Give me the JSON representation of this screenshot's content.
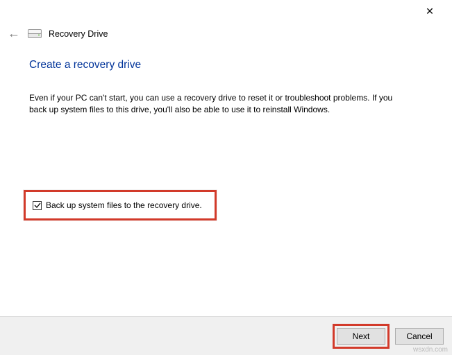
{
  "window": {
    "close_tooltip": "Close"
  },
  "header": {
    "title": "Recovery Drive"
  },
  "page": {
    "title": "Create a recovery drive",
    "description": "Even if your PC can't start, you can use a recovery drive to reset it or troubleshoot problems. If you back up system files to this drive, you'll also be able to use it to reinstall Windows."
  },
  "checkbox": {
    "label": "Back up system files to the recovery drive.",
    "checked": true
  },
  "buttons": {
    "next": "Next",
    "cancel": "Cancel"
  },
  "watermark": "wsxdn.com",
  "highlight_color": "#d23a2a"
}
